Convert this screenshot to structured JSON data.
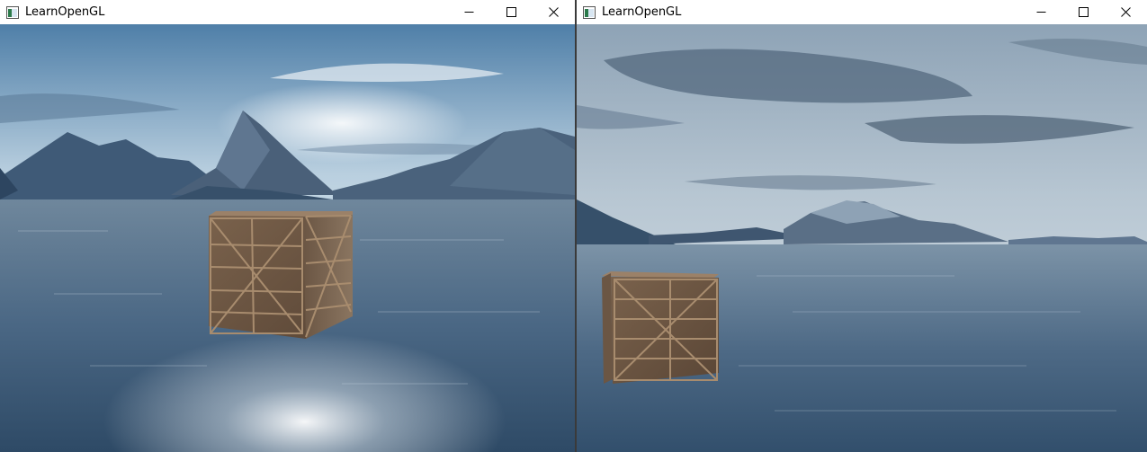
{
  "windows": [
    {
      "title": "LearnOpenGL",
      "controls": {
        "minimize": "minimize-icon",
        "maximize": "maximize-icon",
        "close": "close-icon"
      },
      "scene": "skybox with mountains, sea and textured wooden crate (cube map reflection)"
    },
    {
      "title": "LearnOpenGL",
      "controls": {
        "minimize": "minimize-icon",
        "maximize": "maximize-icon",
        "close": "close-icon"
      },
      "scene": "skybox with mountains, sea and textured wooden crate (alternate camera angle)"
    }
  ],
  "colors": {
    "titlebar_bg": "#ffffff",
    "title_text": "#000000",
    "sky_top": "#4f7fa8",
    "sea": "#46607c",
    "crate": "#6e5846"
  }
}
